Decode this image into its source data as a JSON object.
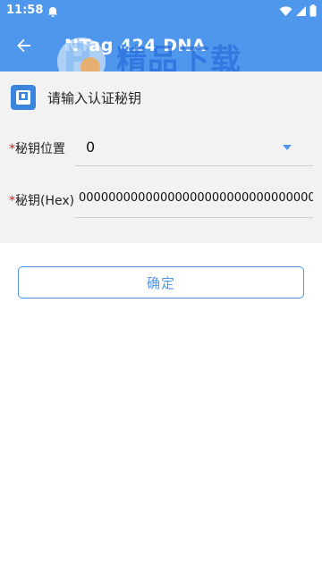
{
  "status_bar": {
    "time": "11:58",
    "icons": [
      "notification-icon",
      "wifi-icon",
      "cell-signal-icon",
      "battery-icon"
    ]
  },
  "app_bar": {
    "title": "NTag 424 DNA",
    "back_icon": "arrow-left-icon"
  },
  "watermark": {
    "text": "精品下载",
    "url": "www.jyp.com"
  },
  "section": {
    "icon": "card-icon",
    "title": "请输入认证秘钥"
  },
  "fields": {
    "key_slot": {
      "required_mark": "*",
      "label": "秘钥位置",
      "value": "0"
    },
    "key_hex": {
      "required_mark": "*",
      "label": "秘钥(Hex)",
      "value": "00000000000000000000000000000000"
    }
  },
  "actions": {
    "confirm_label": "确定"
  },
  "colors": {
    "primary": "#4f97ec",
    "required": "#e02020",
    "panel_bg": "#f2f2f2"
  }
}
